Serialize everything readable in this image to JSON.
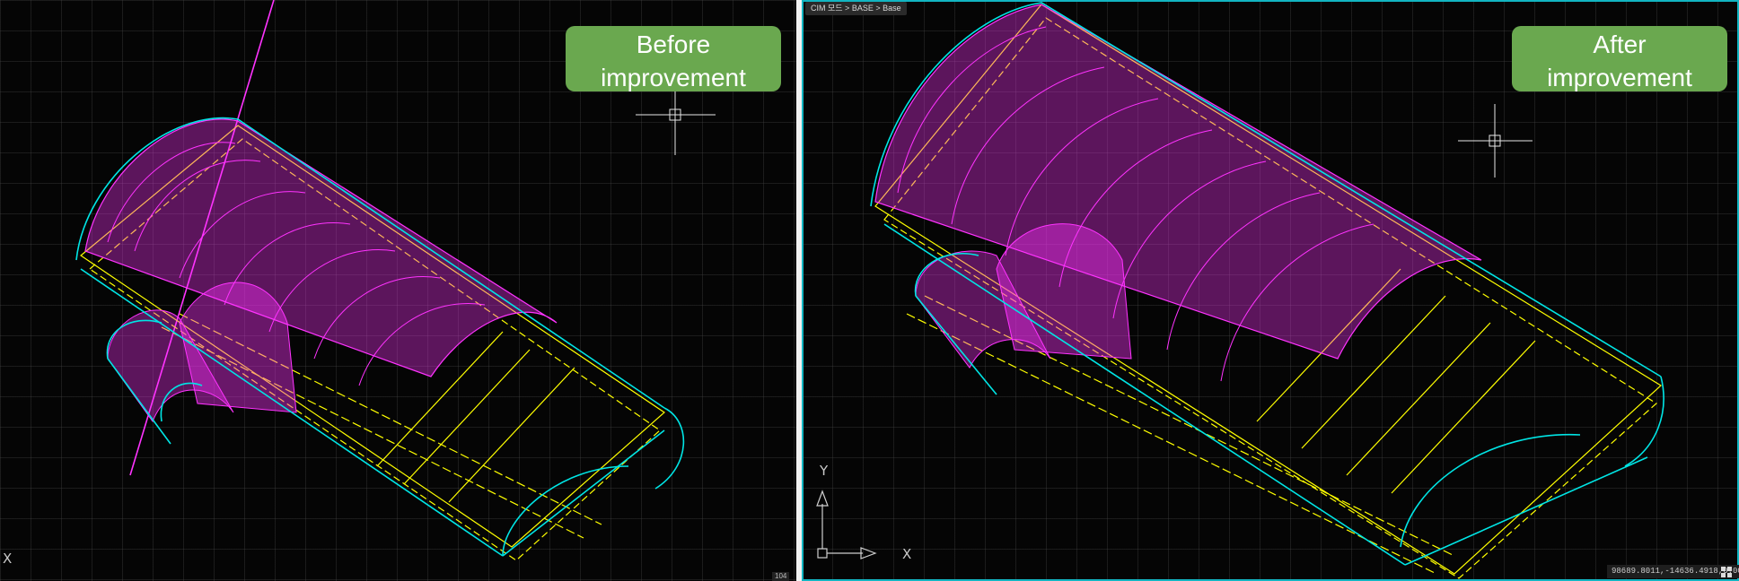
{
  "before_panel": {
    "badge": "Before improvement",
    "corner_label": "104",
    "axis_x_label": "X"
  },
  "after_panel": {
    "badge": "After improvement",
    "breadcrumb": "CIM 모드 > BASE > Base",
    "coordinates": "98689.8011,-14636.4918,0.0000",
    "ucs_icon": {
      "x_label": "X",
      "y_label": "Y"
    }
  },
  "colors": {
    "background": "#050505",
    "tunnel_mesh": "#ff33ff",
    "rebar_lines": "#ffff00",
    "tunnel_outline": "#00e5e5",
    "badge": "#6aa84f",
    "panel_border": "#12b5c2"
  },
  "icons": [
    "crosshair-cursor-icon",
    "ucs-icon",
    "grid-settings-icon"
  ]
}
